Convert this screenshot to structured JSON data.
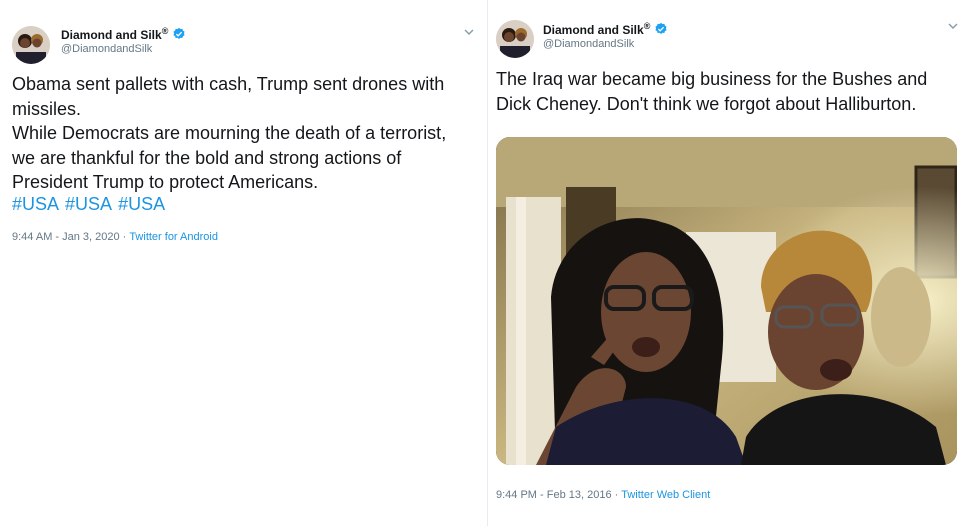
{
  "tweets": [
    {
      "author": {
        "name": "Diamond and Silk",
        "registered": "®",
        "handle": "@DiamondandSilk"
      },
      "text": "Obama sent pallets with cash, Trump sent drones with\nmissiles.\nWhile Democrats are mourning the death of a terrorist,\nwe are thankful for the bold and strong actions of\nPresident Trump to protect Americans.",
      "hashtags": [
        "#USA",
        "#USA",
        "#USA"
      ],
      "timestamp": "9:44 AM - Jan 3, 2020",
      "separator": "·",
      "client": "Twitter for Android"
    },
    {
      "author": {
        "name": "Diamond and Silk",
        "registered": "®",
        "handle": "@DiamondandSilk"
      },
      "text": "The Iraq war became big business for the Bushes and\nDick Cheney.  Don't think we forgot about Halliburton.",
      "timestamp": "9:44 PM - Feb 13, 2016",
      "separator": "·",
      "client": "Twitter Web Client"
    }
  ],
  "colors": {
    "link": "#1b95e0",
    "verified": "#1da1f2",
    "muted": "#657786",
    "text": "#14171a"
  },
  "icons": {
    "verified": "verified-badge-icon",
    "menu": "chevron-down-icon"
  }
}
